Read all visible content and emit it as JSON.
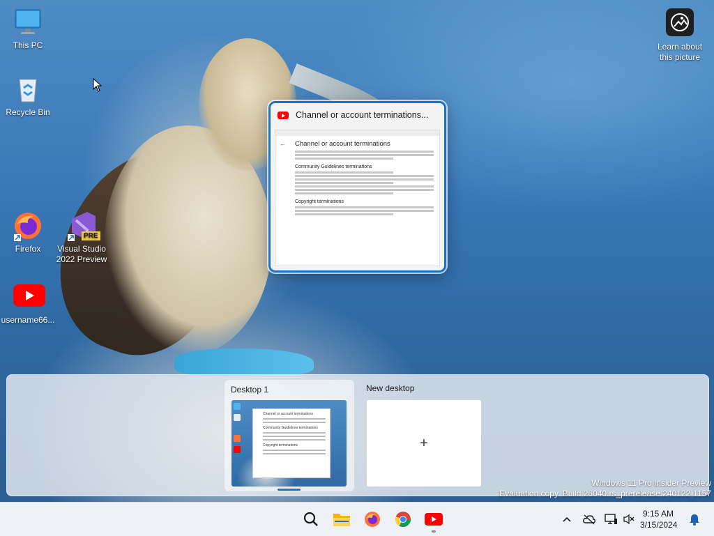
{
  "desktop": {
    "icons": [
      {
        "label": "This PC",
        "icon": "this-pc-icon"
      },
      {
        "label": "Recycle Bin",
        "icon": "recycle-bin-icon"
      },
      {
        "label": "Firefox",
        "icon": "firefox-icon"
      },
      {
        "label": "Visual Studio 2022 Preview",
        "icon": "visual-studio-preview-icon",
        "badge": "PRE"
      },
      {
        "label": "username66...",
        "icon": "youtube-shortcut-icon"
      }
    ],
    "learn_about_picture": {
      "label": "Learn about this picture",
      "icon": "learn-picture-icon"
    }
  },
  "task_view": {
    "window": {
      "title": "Channel or account terminations...",
      "icon": "youtube-logo-icon",
      "page": {
        "heading": "Channel or account terminations",
        "section1": "Community Guidelines terminations",
        "section2": "Copyright terminations"
      }
    },
    "desktops": [
      {
        "label": "Desktop 1",
        "active": true
      },
      {
        "label": "New desktop",
        "symbol": "+"
      }
    ],
    "thumbnail_heading": "Channel or account terminations",
    "thumbnail_section": "Community Guidelines terminations",
    "thumbnail_section2": "Copyright terminations"
  },
  "watermark": {
    "line1": "Windows 11 Pro Insider Preview",
    "line2": "Evaluation copy. Build 26040.rs_prerelease.240122-1157"
  },
  "taskbar": {
    "apps": [
      "search-icon",
      "file-explorer-icon",
      "firefox-icon",
      "chrome-icon",
      "youtube-app-icon"
    ],
    "tray": [
      "chevron-up-icon",
      "onedrive-offline-icon",
      "network-icon",
      "volume-muted-icon",
      "notification-bell-icon"
    ],
    "time": "9:15 AM",
    "date": "3/15/2024"
  },
  "colors": {
    "accent": "#1a73c9",
    "youtube_red": "#ff0000",
    "taskbar_bg": "#eef1f5"
  }
}
